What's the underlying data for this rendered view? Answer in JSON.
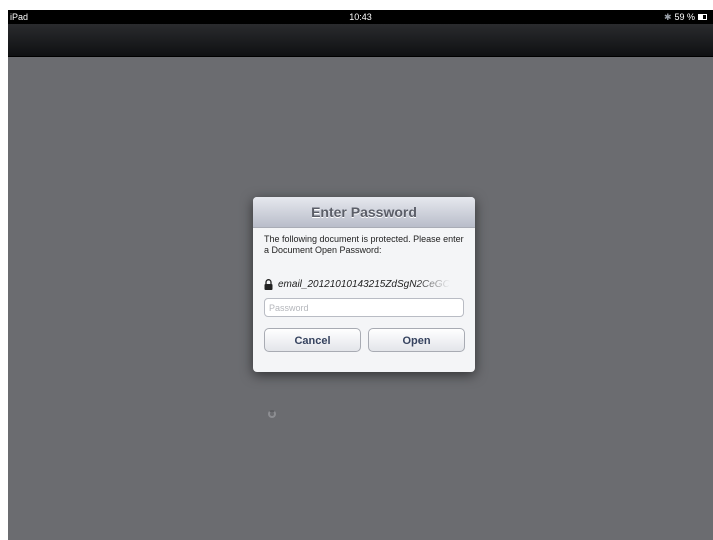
{
  "status_bar": {
    "device": "iPad",
    "time": "10:43",
    "battery_text": "59 %",
    "battery_level": 0.59
  },
  "dialog": {
    "title": "Enter Password",
    "message": "The following document is protected. Please enter a Document Open Password:",
    "file_name": "email_20121010143215ZdSgN2CeGC",
    "password_placeholder": "Password",
    "password_value": "",
    "cancel_label": "Cancel",
    "open_label": "Open"
  },
  "icons": {
    "lock": "lock-icon",
    "bluetooth": "bluetooth-icon",
    "battery": "battery-icon",
    "spinner": "loading-spinner-icon"
  },
  "colors": {
    "background": "#6b6c70",
    "nav_bar": "#1a1b1e",
    "button_text": "#36435f"
  }
}
